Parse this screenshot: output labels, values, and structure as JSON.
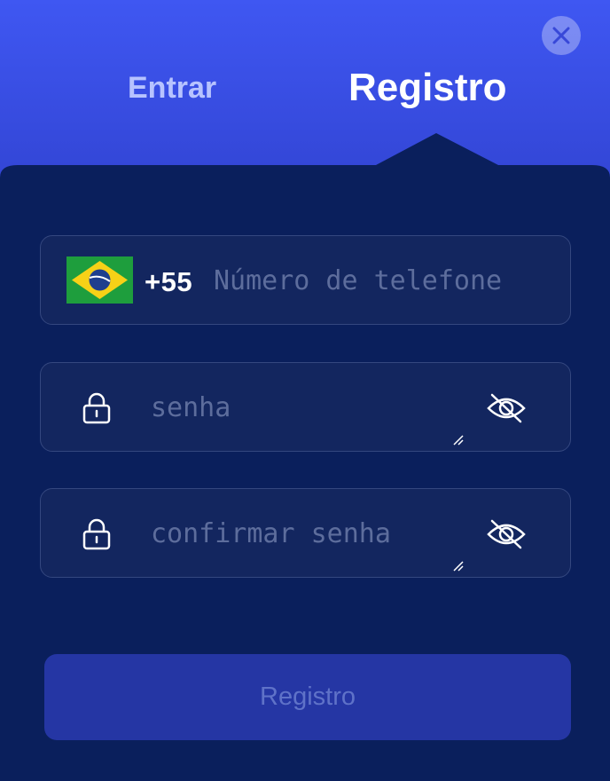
{
  "header": {
    "tabs": [
      {
        "label": "Entrar",
        "active": false
      },
      {
        "label": "Registro",
        "active": true
      }
    ],
    "close_icon": "close-icon"
  },
  "form": {
    "phone": {
      "country_flag": "brazil-flag-icon",
      "country_code": "+55",
      "placeholder": "Número de telefone",
      "value": ""
    },
    "password": {
      "placeholder": "senha",
      "value": "",
      "lock_icon": "lock-icon",
      "toggle_icon": "eye-off-icon"
    },
    "confirm_password": {
      "placeholder": "confirmar senha",
      "value": "",
      "lock_icon": "lock-icon",
      "toggle_icon": "eye-off-icon"
    },
    "submit_label": "Registro"
  },
  "colors": {
    "header_gradient_top": "#3f57f2",
    "panel_bg": "#0a1f5c",
    "field_bg": "#13265f",
    "submit_bg": "#2536a4",
    "brand_active_text": "#ffffff",
    "tab_inactive_text": "#b7c3ff"
  }
}
